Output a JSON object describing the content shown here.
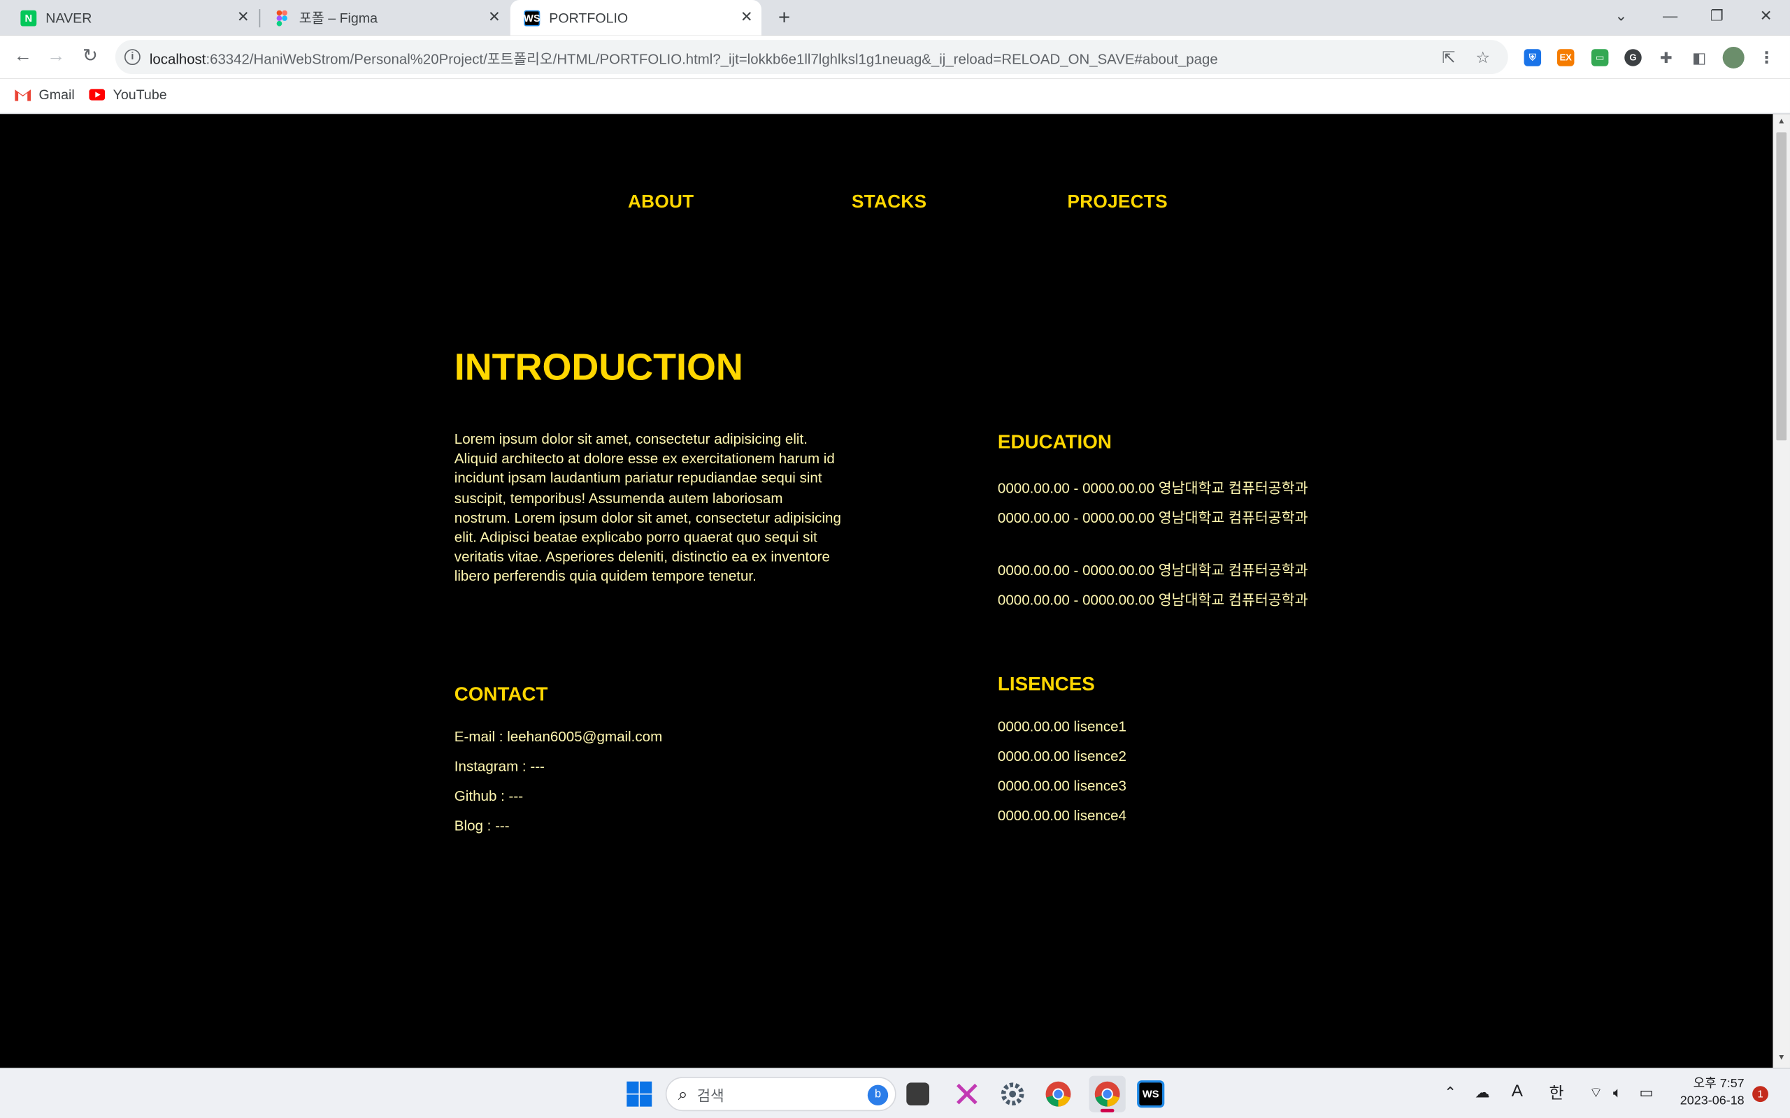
{
  "browser": {
    "tabs": [
      {
        "title": "NAVER",
        "icon": "naver-favicon",
        "active": false
      },
      {
        "title": "포폴 – Figma",
        "icon": "figma-favicon",
        "active": false
      },
      {
        "title": "PORTFOLIO",
        "icon": "webstorm-favicon",
        "active": true
      }
    ],
    "url_host": "localhost",
    "url_rest": ":63342/HaniWebStrom/Personal%20Project/포트폴리오/HTML/PORTFOLIO.html?_ijt=lokkb6e1ll7lghlksl1g1neuag&_ij_reload=RELOAD_ON_SAVE#about_page",
    "bookmarks": [
      {
        "label": "Gmail",
        "icon": "gmail-icon"
      },
      {
        "label": "YouTube",
        "icon": "youtube-icon"
      }
    ]
  },
  "page": {
    "nav": [
      "ABOUT",
      "STACKS",
      "PROJECTS"
    ],
    "introduction": {
      "title": "INTRODUCTION",
      "text": "Lorem ipsum dolor sit amet, consectetur adipisicing elit. Aliquid architecto at dolore esse ex exercitationem harum id incidunt ipsam laudantium pariatur repudiandae sequi sint suscipit, temporibus! Assumenda autem laboriosam nostrum. Lorem ipsum dolor sit amet, consectetur adipisicing elit. Adipisci beatae explicabo porro quaerat quo sequi sit veritatis vitae. Asperiores deleniti, distinctio ea ex inventore libero perferendis quia quidem tempore tenetur."
    },
    "education": {
      "title": "EDUCATION",
      "items": [
        "0000.00.00 - 0000.00.00 영남대학교 컴퓨터공학과",
        "0000.00.00 - 0000.00.00 영남대학교 컴퓨터공학과",
        "0000.00.00 - 0000.00.00 영남대학교 컴퓨터공학과",
        "0000.00.00 - 0000.00.00 영남대학교 컴퓨터공학과"
      ]
    },
    "contact": {
      "title": "CONTACT",
      "items": [
        "E-mail : leehan6005@gmail.com",
        "Instagram : ---",
        "Github : ---",
        "Blog : ---"
      ]
    },
    "licences": {
      "title": "LISENCES",
      "items": [
        "0000.00.00 lisence1",
        "0000.00.00 lisence2",
        "0000.00.00 lisence3",
        "0000.00.00 lisence4"
      ]
    }
  },
  "taskbar": {
    "search_placeholder": "검색",
    "ime_label": "한",
    "font_label": "A",
    "time": "오후 7:57",
    "date": "2023-06-18",
    "notification_count": "1"
  },
  "colors": {
    "page_bg": "#000000",
    "accent": "#ffd700",
    "body_text": "#fff7b0"
  }
}
